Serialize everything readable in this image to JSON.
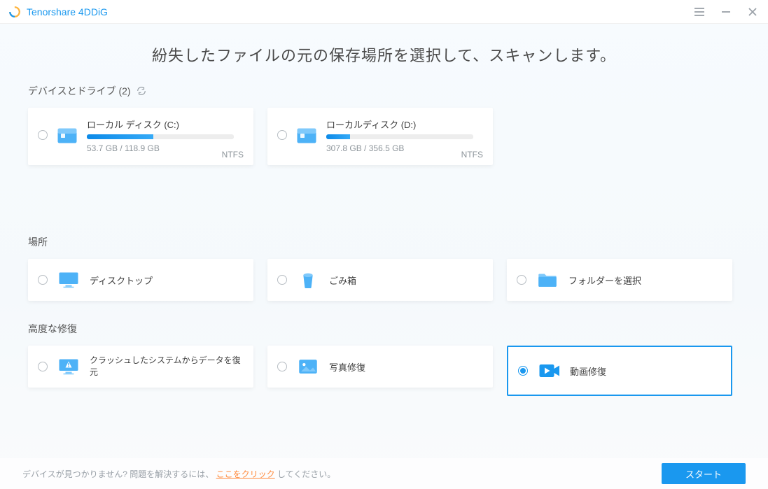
{
  "brand": {
    "name": "Tenorshare 4DDiG",
    "accent": "#1a98ef"
  },
  "page_title": "紛失したファイルの元の保存場所を選択して、スキャンします。",
  "sections": {
    "drives": {
      "title": "デバイスとドライブ (2)"
    },
    "locations": {
      "title": "場所"
    },
    "advanced": {
      "title": "高度な修復"
    }
  },
  "drives": [
    {
      "name": "ローカル ディスク (C:)",
      "used": "53.7 GB",
      "total": "118.9 GB",
      "fs": "NTFS",
      "percent": 45
    },
    {
      "name": "ローカルディスク (D:)",
      "used": "307.8 GB",
      "total": "356.5 GB",
      "fs": "NTFS",
      "percent": 16
    }
  ],
  "locations": [
    {
      "label": "ディスクトップ"
    },
    {
      "label": "ごみ箱"
    },
    {
      "label": "フォルダーを選択"
    }
  ],
  "advanced": [
    {
      "label": "クラッシュしたシステムからデータを復元"
    },
    {
      "label": "写真修復"
    },
    {
      "label": "動画修復",
      "selected": true
    }
  ],
  "footer": {
    "pre": "デバイスが見つかりません? 問題を解決するには、",
    "link": "ここをクリック",
    "post": "してください。",
    "start": "スタート"
  }
}
